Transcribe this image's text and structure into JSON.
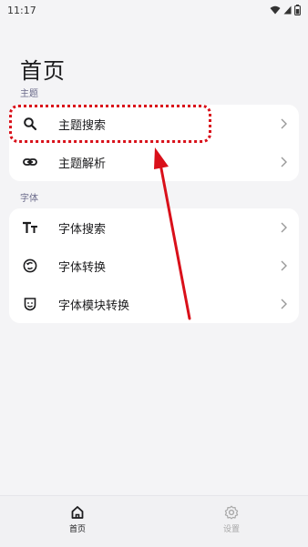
{
  "status": {
    "time": "11:17"
  },
  "page_title": "首页",
  "sections": [
    {
      "label": "主题",
      "items": [
        {
          "label": "主题搜索",
          "icon": "search-icon"
        },
        {
          "label": "主题解析",
          "icon": "link-icon"
        }
      ]
    },
    {
      "label": "字体",
      "items": [
        {
          "label": "字体搜索",
          "icon": "font-size-icon"
        },
        {
          "label": "字体转换",
          "icon": "font-convert-icon"
        },
        {
          "label": "字体模块转换",
          "icon": "font-module-icon"
        }
      ]
    }
  ],
  "bottom_nav": [
    {
      "label": "首页",
      "icon": "home-icon",
      "active": true
    },
    {
      "label": "设置",
      "icon": "gear-icon",
      "active": false
    }
  ],
  "colors": {
    "annotation": "#d9101a",
    "inactive_nav": "#a8a8a8"
  }
}
